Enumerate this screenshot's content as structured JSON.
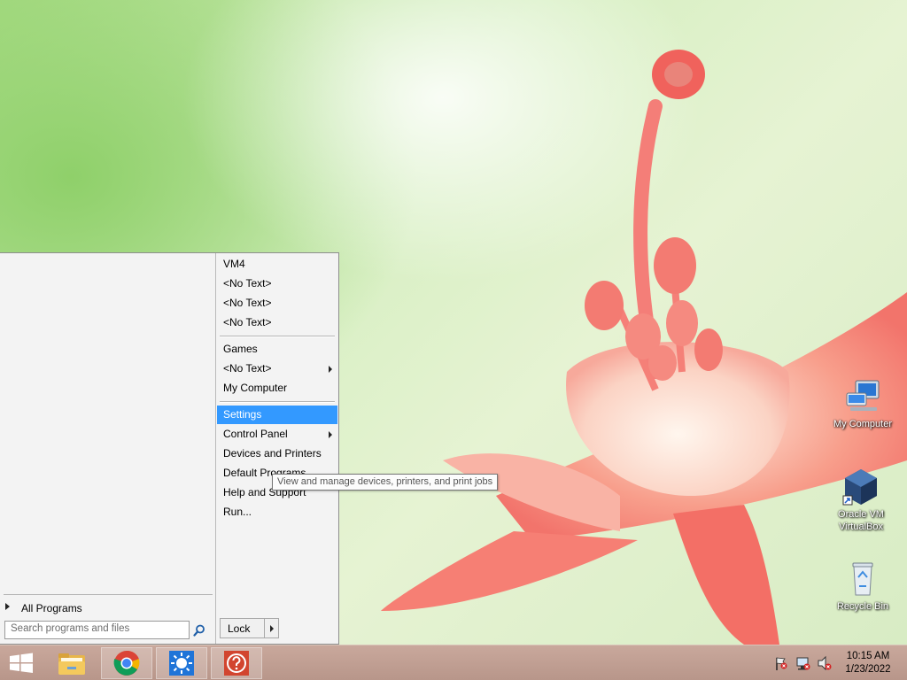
{
  "desktop": {
    "icons": [
      {
        "label": "My Computer",
        "icon": "computer-icon"
      },
      {
        "label": "Oracle VM VirtualBox",
        "line1": "Oracle VM",
        "line2": "VirtualBox",
        "icon": "virtualbox-icon"
      },
      {
        "label": "Recycle Bin",
        "icon": "recycle-bin-icon"
      }
    ]
  },
  "startmenu": {
    "all_programs": "All Programs",
    "search_placeholder": "Search programs and files",
    "right_items": [
      {
        "label": "VM4"
      },
      {
        "label": "<No Text>"
      },
      {
        "label": "<No Text>"
      },
      {
        "label": "<No Text>"
      },
      {
        "label": "Games"
      },
      {
        "label": "<No Text>",
        "submenu": true
      },
      {
        "label": "My Computer"
      },
      {
        "label": "Settings",
        "selected": true
      },
      {
        "label": "Control Panel",
        "submenu": true
      },
      {
        "label": "Devices and Printers"
      },
      {
        "label": "Default Programs"
      },
      {
        "label": "Help and Support"
      },
      {
        "label": "Run..."
      }
    ],
    "lock_label": "Lock"
  },
  "tooltip": {
    "text": "View and manage devices, printers, and print jobs"
  },
  "taskbar": {
    "apps": [
      {
        "name": "start-button",
        "icon": "windows-logo-icon"
      },
      {
        "name": "file-explorer",
        "icon": "folder-icon"
      },
      {
        "name": "chrome",
        "icon": "chrome-icon"
      },
      {
        "name": "weather-app",
        "icon": "sun-icon"
      },
      {
        "name": "help-app",
        "icon": "help-icon"
      }
    ],
    "clock": {
      "time": "10:15 AM",
      "date": "1/23/2022"
    }
  },
  "colors": {
    "accent": "#3399ff",
    "taskbar": "#c3a296"
  }
}
